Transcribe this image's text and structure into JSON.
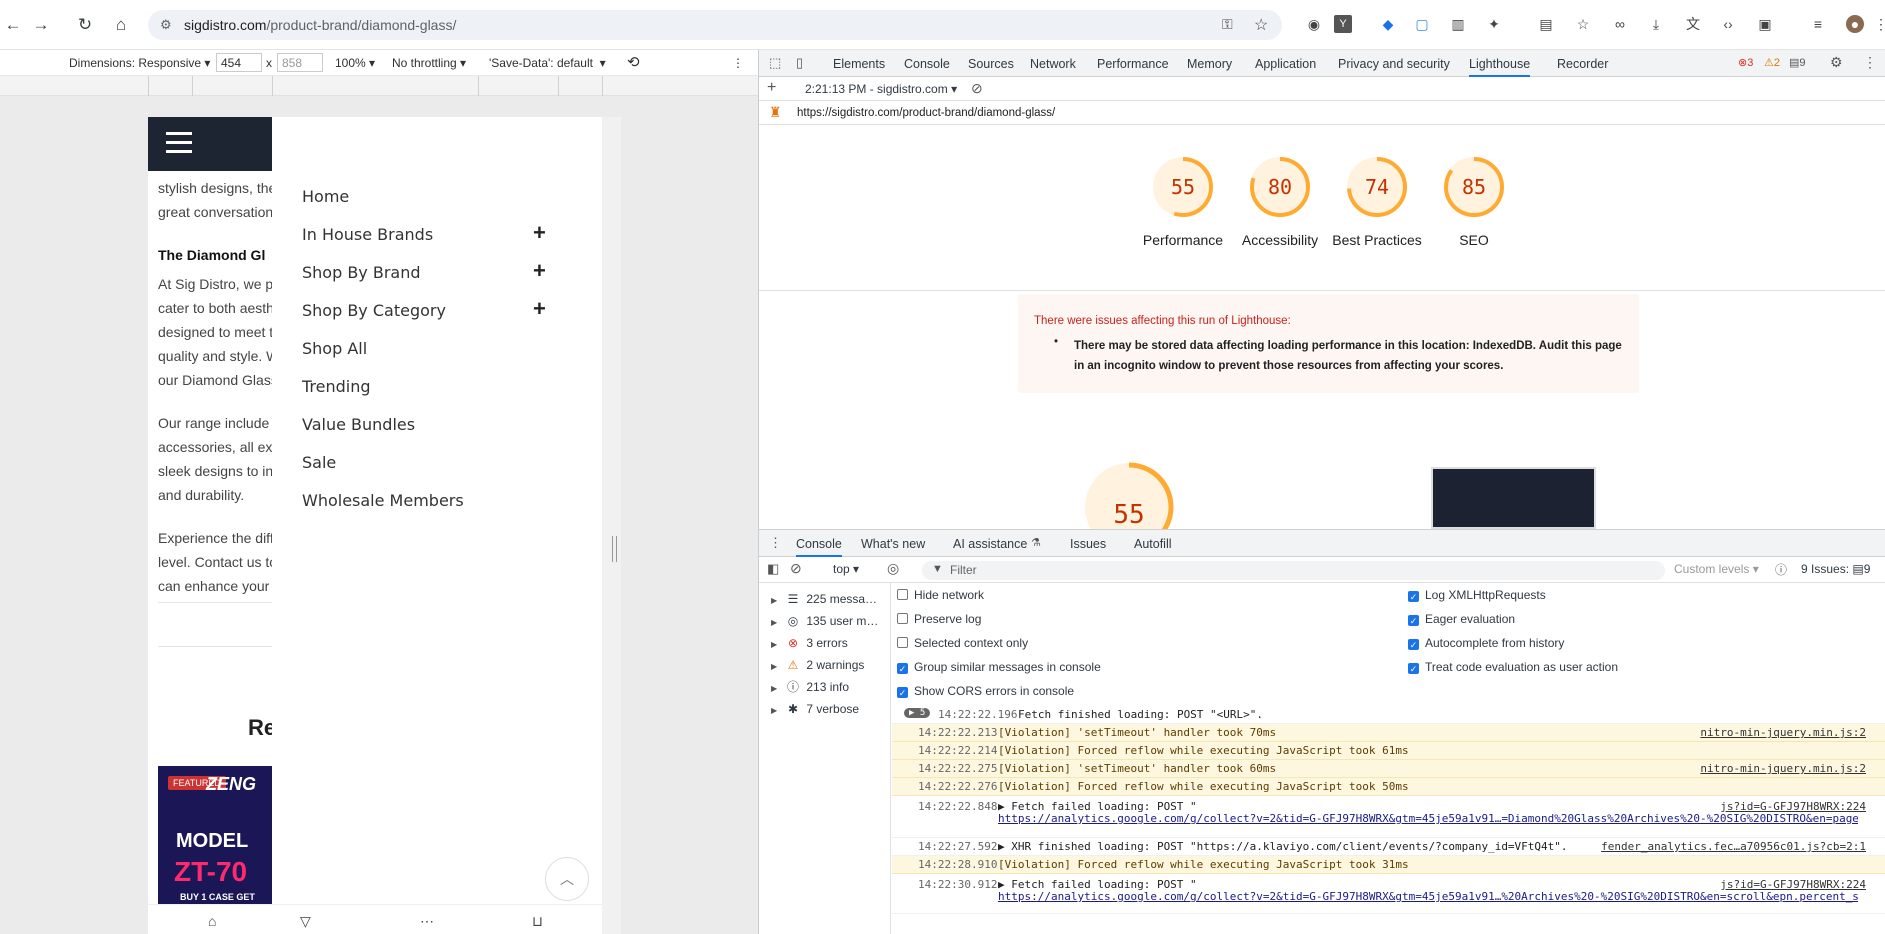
{
  "browser": {
    "url_host": "sigdistro.com",
    "url_path": "/product-brand/diamond-glass/"
  },
  "device_toolbar": {
    "dimensions": "Dimensions: Responsive",
    "width": "454",
    "height_placeholder": "858",
    "x": "x",
    "zoom": "100%",
    "throttling": "No throttling",
    "save_data": "'Save-Data': default"
  },
  "mobile_page": {
    "text_lines": [
      "stylish designs, the",
      "great conversation",
      "The Diamond Gl",
      "At Sig Distro, we p",
      "cater to both aesthe",
      "designed to meet t",
      "quality and style. W",
      "our Diamond Glass",
      "Our range include",
      "accessories, all exp",
      "sleek designs to in",
      "and durability.",
      "Experience the diff",
      "level. Contact us to",
      "can enhance your"
    ],
    "section_title": "Re",
    "featured_badge": "FEATURED",
    "product_brand": "ZENG",
    "product_model": "MODEL",
    "product_name": "ZT-70",
    "product_promo": "BUY 1 CASE GET",
    "menu": [
      {
        "label": "Home",
        "expandable": false
      },
      {
        "label": "In House Brands",
        "expandable": true
      },
      {
        "label": "Shop By Brand",
        "expandable": true
      },
      {
        "label": "Shop By Category",
        "expandable": true
      },
      {
        "label": "Shop All",
        "expandable": false
      },
      {
        "label": "Trending",
        "expandable": false
      },
      {
        "label": "Value Bundles",
        "expandable": false
      },
      {
        "label": "Sale",
        "expandable": false
      },
      {
        "label": "Wholesale Members",
        "expandable": false
      }
    ],
    "plus_symbol": "+"
  },
  "devtools": {
    "tabs": [
      "Elements",
      "Console",
      "Sources",
      "Network",
      "Performance",
      "Memory",
      "Application",
      "Privacy and security",
      "Lighthouse",
      "Recorder"
    ],
    "active_tab": "Lighthouse",
    "error_count": "3",
    "warning_count": "2",
    "issue_count": "9",
    "lighthouse": {
      "run_label": "2:21:13 PM - sigdistro.com",
      "url": "https://sigdistro.com/product-brand/diamond-glass/",
      "scores": [
        {
          "value": 55,
          "label": "Performance",
          "color": "#fa3",
          "bg": "#fff3e0",
          "text_color": "#c33300"
        },
        {
          "value": 80,
          "label": "Accessibility",
          "color": "#fa3",
          "bg": "#fff3e0",
          "text_color": "#c33300"
        },
        {
          "value": 74,
          "label": "Best Practices",
          "color": "#fa3",
          "bg": "#fff3e0",
          "text_color": "#c33300"
        },
        {
          "value": 85,
          "label": "SEO",
          "color": "#fa3",
          "bg": "#fff3e0",
          "text_color": "#c33300"
        }
      ],
      "warning_title": "There were issues affecting this run of Lighthouse:",
      "warning_body": "There may be stored data affecting loading performance in this location: IndexedDB. Audit this page in an incognito window to prevent those resources from affecting your scores.",
      "big_score": "55"
    },
    "drawer_tabs": [
      "Console",
      "What's new",
      "AI assistance",
      "Issues",
      "Autofill"
    ],
    "console": {
      "context": "top",
      "filter_placeholder": "Filter",
      "levels": "Custom levels",
      "issues": "9 Issues:",
      "issues_count": "9",
      "sidebar": [
        {
          "label": "225 messa…",
          "icon": "list-icon"
        },
        {
          "label": "135 user m…",
          "icon": "user-icon"
        },
        {
          "label": "3 errors",
          "icon": "error-icon"
        },
        {
          "label": "2 warnings",
          "icon": "warning-icon"
        },
        {
          "label": "213 info",
          "icon": "info-icon"
        },
        {
          "label": "7 verbose",
          "icon": "bug-icon"
        }
      ],
      "settings_left": [
        {
          "label": "Hide network",
          "checked": false
        },
        {
          "label": "Preserve log",
          "checked": false
        },
        {
          "label": "Selected context only",
          "checked": false
        },
        {
          "label": "Group similar messages in console",
          "checked": true
        },
        {
          "label": "Show CORS errors in console",
          "checked": true
        }
      ],
      "settings_right": [
        {
          "label": "Log XMLHttpRequests",
          "checked": true
        },
        {
          "label": "Eager evaluation",
          "checked": true
        },
        {
          "label": "Autocomplete from history",
          "checked": true
        },
        {
          "label": "Treat code evaluation as user action",
          "checked": true
        }
      ],
      "logs": [
        {
          "count": "5",
          "ts": "14:22:22.196",
          "msg": "Fetch finished loading: POST \"<URL>\".",
          "src": "",
          "sub": "",
          "kind": "info"
        },
        {
          "ts": "14:22:22.213",
          "msg": "[Violation] 'setTimeout' handler took 70ms",
          "src": "nitro-min-jquery.min.js:2",
          "sub": "",
          "kind": "warn"
        },
        {
          "ts": "14:22:22.214",
          "msg": "[Violation] Forced reflow while executing JavaScript took 61ms",
          "src": "",
          "sub": "",
          "kind": "warn"
        },
        {
          "ts": "14:22:22.275",
          "msg": "[Violation] 'setTimeout' handler took 60ms",
          "src": "nitro-min-jquery.min.js:2",
          "sub": "",
          "kind": "warn"
        },
        {
          "ts": "14:22:22.276",
          "msg": "[Violation] Forced reflow while executing JavaScript took 50ms",
          "src": "",
          "sub": "",
          "kind": "warn"
        },
        {
          "ts": "14:22:22.848",
          "msg": "▶ Fetch failed loading: POST \"",
          "src": "js?id=G-GFJ97H8WRX:224",
          "sub": "https://analytics.google.com/g/collect?v=2&tid=G-GFJ97H8WRX&gtm=45je59a1v91…=Diamond%20Glass%20Archives%20-%20SIG%20DISTRO&en=page…",
          "kind": "info"
        },
        {
          "ts": "14:22:27.592",
          "msg": "▶ XHR finished loading: POST \"https://a.klaviyo.com/client/events/?company_id=VFtQ4t\".",
          "src": "fender_analytics.fec…a70956c01.js?cb=2:1",
          "sub": "",
          "kind": "info"
        },
        {
          "ts": "14:22:28.910",
          "msg": "[Violation] Forced reflow while executing JavaScript took 31ms",
          "src": "",
          "sub": "",
          "kind": "warn"
        },
        {
          "ts": "14:22:30.912",
          "msg": "▶ Fetch failed loading: POST \"",
          "src": "js?id=G-GFJ97H8WRX:224",
          "sub": "https://analytics.google.com/g/collect?v=2&tid=G-GFJ97H8WRX&gtm=45je59a1v91…%20Archives%20-%20SIG%20DISTRO&en=scroll&epn.percent_s…",
          "kind": "info"
        }
      ]
    }
  }
}
